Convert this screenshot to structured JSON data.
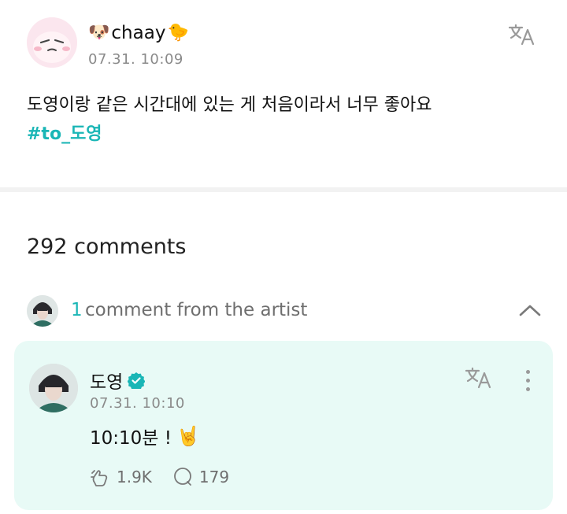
{
  "post": {
    "author_name": "chaay",
    "author_emoji_left": "🐶",
    "author_emoji_right": "🐤",
    "timestamp": "07.31. 10:09",
    "body": "도영이랑 같은 시간대에 있는 게 처음이라서 너무 좋아요",
    "hashtag": "#to_도영"
  },
  "comments": {
    "count_label": "292 comments"
  },
  "artist_section": {
    "count": "1",
    "label": "comment from the artist"
  },
  "artist_comment": {
    "author": "도영",
    "timestamp": "07.31. 10:10",
    "text": "10:10분 !",
    "emoji": "🤘",
    "likes": "1.9K",
    "replies": "179"
  },
  "colors": {
    "accent": "#1ab6b6",
    "card_bg": "#e8faf6",
    "muted_text": "#8a8a8a"
  },
  "icons": [
    "translate-icon",
    "verified-badge-icon",
    "chevron-up-icon",
    "more-vertical-icon",
    "like-icon",
    "comment-icon"
  ]
}
